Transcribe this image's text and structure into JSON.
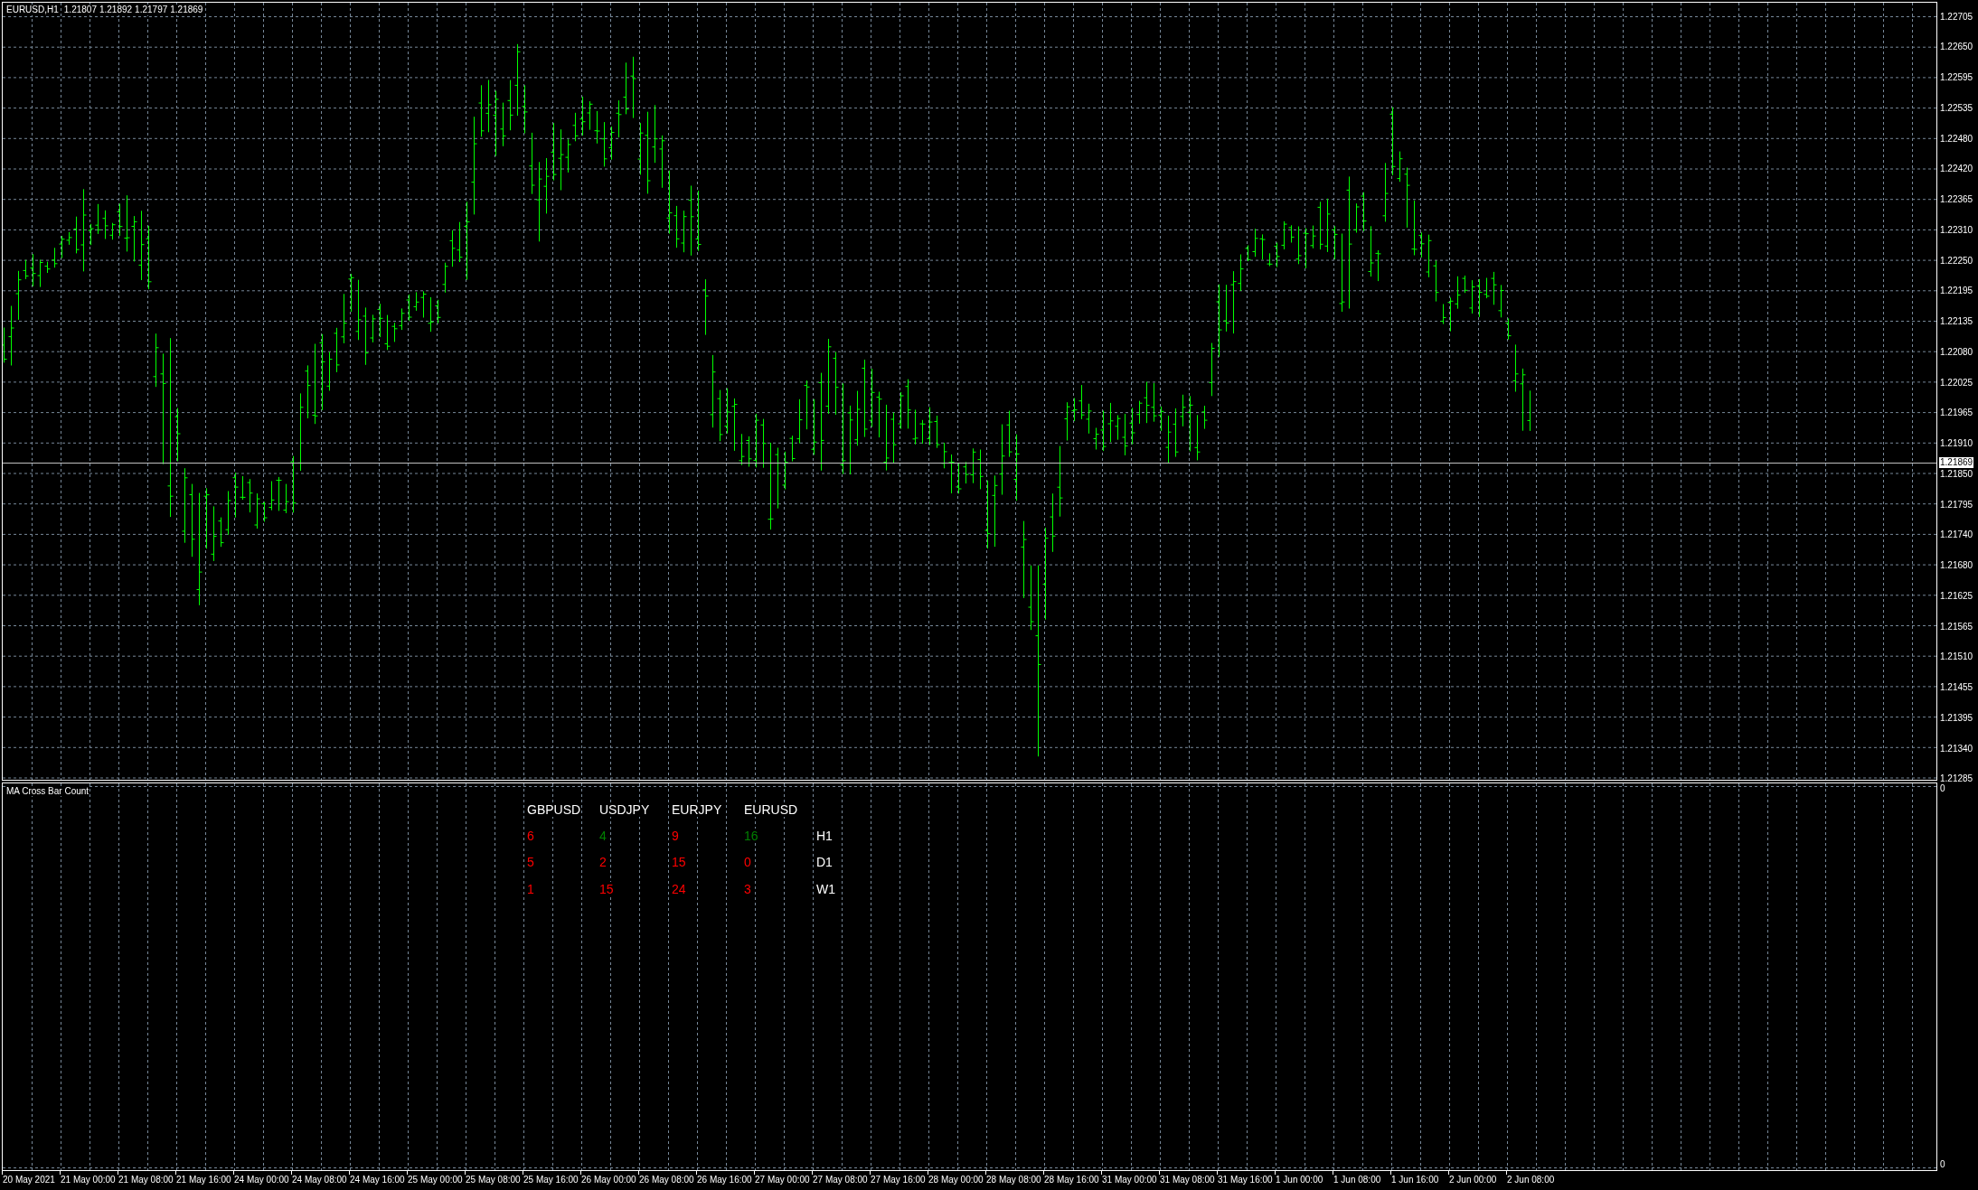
{
  "chart": {
    "symbol": "EURUSD,H1",
    "ohlc": [
      "1.21807",
      "1.21892",
      "1.21797",
      "1.21869"
    ],
    "current_price": "1.21869"
  },
  "price_axis": {
    "labels": [
      "1.22705",
      "1.22650",
      "1.22595",
      "1.22535",
      "1.22480",
      "1.22420",
      "1.22365",
      "1.22310",
      "1.22250",
      "1.22195",
      "1.22135",
      "1.22080",
      "1.22025",
      "1.21965",
      "1.21910",
      "1.21850",
      "1.21795",
      "1.21740",
      "1.21680",
      "1.21625",
      "1.21565",
      "1.21510",
      "1.21455",
      "1.21395",
      "1.21340",
      "1.21285"
    ]
  },
  "indicator": {
    "title": "MA Cross Bar Count",
    "columns": [
      "GBPUSD",
      "USDJPY",
      "EURJPY",
      "EURUSD"
    ],
    "rows": [
      {
        "timeframe": "H1",
        "counts": [
          {
            "value": "6",
            "color": "#ff0000"
          },
          {
            "value": "4",
            "color": "#008000"
          },
          {
            "value": "9",
            "color": "#ff0000"
          },
          {
            "value": "16",
            "color": "#008000"
          }
        ]
      },
      {
        "timeframe": "D1",
        "counts": [
          {
            "value": "5",
            "color": "#ff0000"
          },
          {
            "value": "2",
            "color": "#ff0000"
          },
          {
            "value": "15",
            "color": "#ff0000"
          },
          {
            "value": "0",
            "color": "#ff0000"
          }
        ]
      },
      {
        "timeframe": "W1",
        "counts": [
          {
            "value": "1",
            "color": "#ff0000"
          },
          {
            "value": "15",
            "color": "#ff0000"
          },
          {
            "value": "24",
            "color": "#ff0000"
          },
          {
            "value": "3",
            "color": "#ff0000"
          }
        ]
      }
    ],
    "axis_labels": [
      "0",
      "0"
    ]
  },
  "time_axis": {
    "labels": [
      "20 May 2021",
      "21 May 00:00",
      "21 May 08:00",
      "21 May 16:00",
      "24 May 00:00",
      "24 May 08:00",
      "24 May 16:00",
      "25 May 00:00",
      "25 May 08:00",
      "25 May 16:00",
      "26 May 00:00",
      "26 May 08:00",
      "26 May 16:00",
      "27 May 00:00",
      "27 May 08:00",
      "27 May 16:00",
      "28 May 00:00",
      "28 May 08:00",
      "28 May 16:00",
      "31 May 00:00",
      "31 May 08:00",
      "31 May 16:00",
      "1 Jun 00:00",
      "1 Jun 08:00",
      "1 Jun 16:00",
      "2 Jun 00:00",
      "2 Jun 08:00"
    ]
  }
}
